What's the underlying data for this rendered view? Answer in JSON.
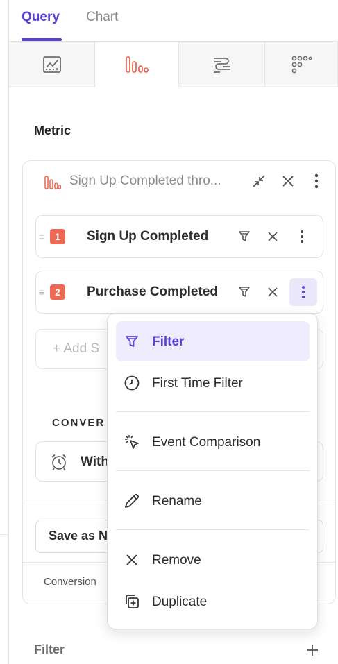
{
  "tabs": {
    "query": "Query",
    "chart": "Chart"
  },
  "chart_types": [
    {
      "icon": "insights-chart-icon"
    },
    {
      "icon": "funnel-chart-icon"
    },
    {
      "icon": "flows-chart-icon"
    },
    {
      "icon": "retention-grid-icon"
    }
  ],
  "metric": {
    "title": "Metric",
    "card_title": "Sign Up Completed thro...",
    "steps": [
      {
        "number": "1",
        "label": "Sign Up Completed"
      },
      {
        "number": "2",
        "label": "Purchase Completed"
      }
    ],
    "add_step_label": "+ Add S",
    "conversion_label": "CONVER",
    "within_label": "With",
    "save_label": "Save as N",
    "footer_label": "Conversion"
  },
  "menu": {
    "items": [
      {
        "label": "Filter",
        "icon": "filter-icon"
      },
      {
        "label": "First Time Filter",
        "icon": "clock-icon"
      },
      {
        "label": "Event Comparison",
        "icon": "cursor-click-icon"
      },
      {
        "label": "Rename",
        "icon": "pencil-icon"
      },
      {
        "label": "Remove",
        "icon": "close-icon"
      },
      {
        "label": "Duplicate",
        "icon": "duplicate-icon"
      }
    ]
  },
  "filter_section": {
    "title": "Filter"
  },
  "colors": {
    "accent": "#5b3fd6",
    "step_badge": "#ef6a55",
    "menu_highlight": "#efecfd"
  }
}
